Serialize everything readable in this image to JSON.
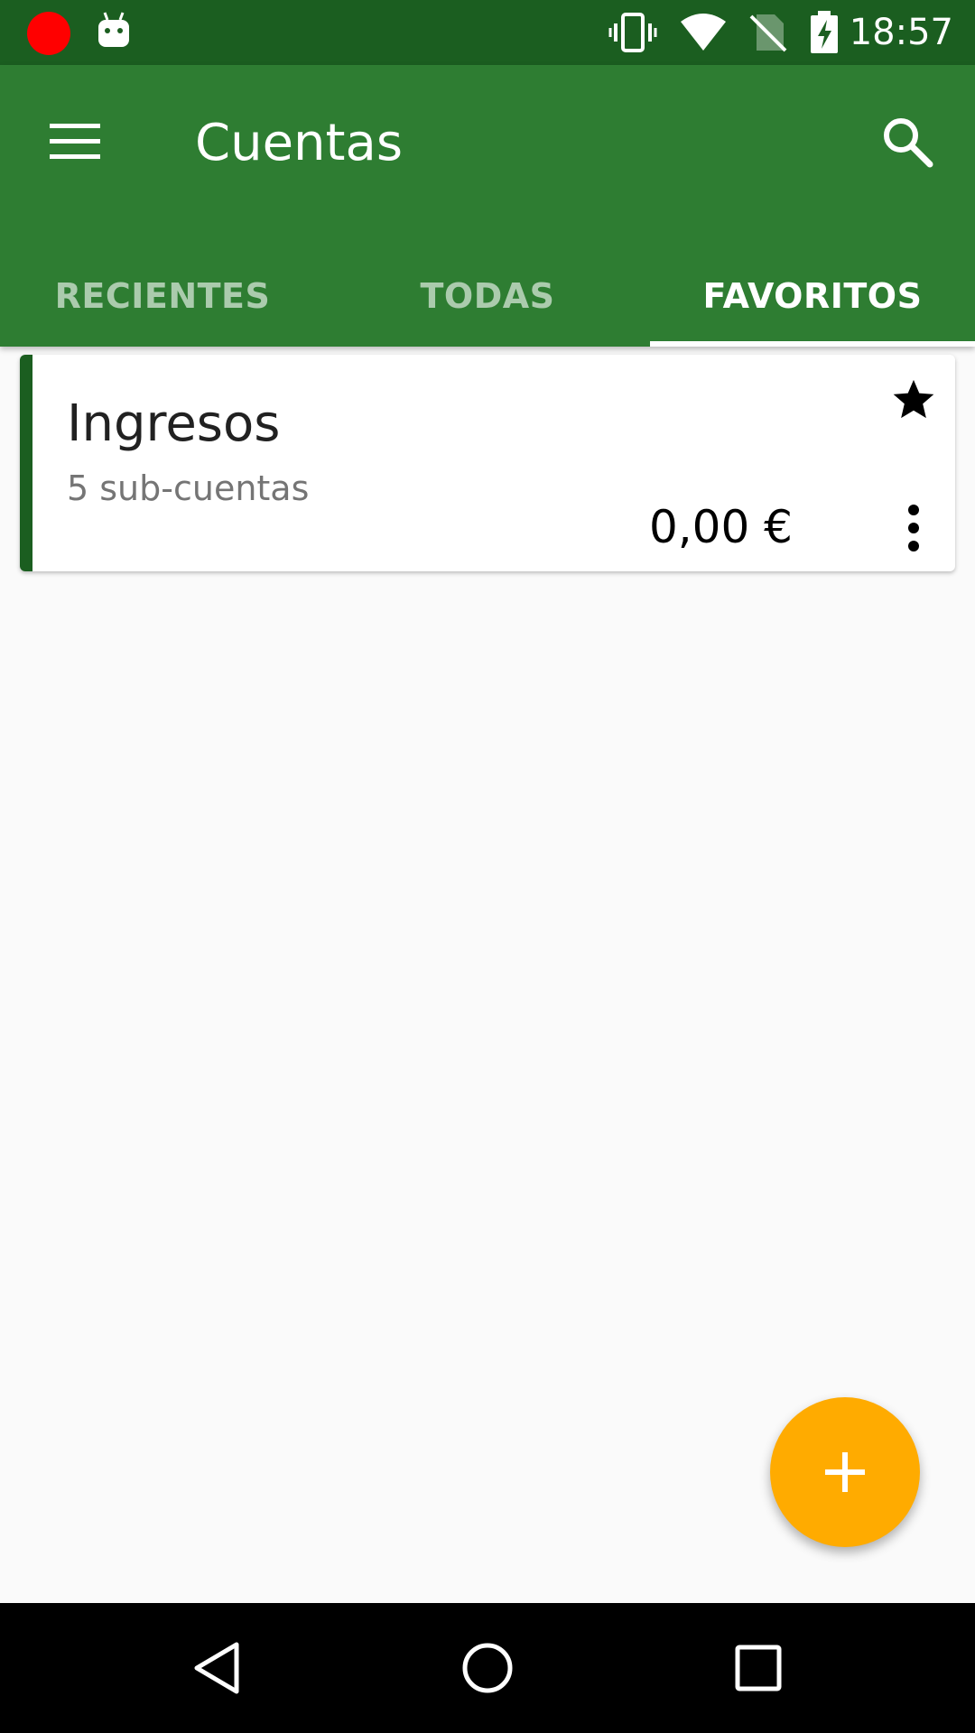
{
  "status_bar": {
    "time": "18:57",
    "icons": [
      "recording-dot",
      "android-debug-icon",
      "vibrate-icon",
      "wifi-icon",
      "no-sim-icon",
      "battery-charging-icon"
    ]
  },
  "app_bar": {
    "title": "Cuentas",
    "menu_icon": "menu-icon",
    "search_icon": "search-icon",
    "background_color": "#2e7d32"
  },
  "tabs": [
    {
      "label": "RECIENTES",
      "active": false
    },
    {
      "label": "TODAS",
      "active": false
    },
    {
      "label": "FAVORITOS",
      "active": true
    }
  ],
  "accounts": [
    {
      "name": "Ingresos",
      "sub_accounts": "5 sub-cuentas",
      "balance": "0,00 €",
      "favorite": true,
      "color": "#1b5e20"
    }
  ],
  "fab": {
    "icon": "plus-icon",
    "color": "#ffab00"
  },
  "nav_bar": {
    "buttons": [
      "back-icon",
      "home-icon",
      "recents-icon"
    ]
  }
}
